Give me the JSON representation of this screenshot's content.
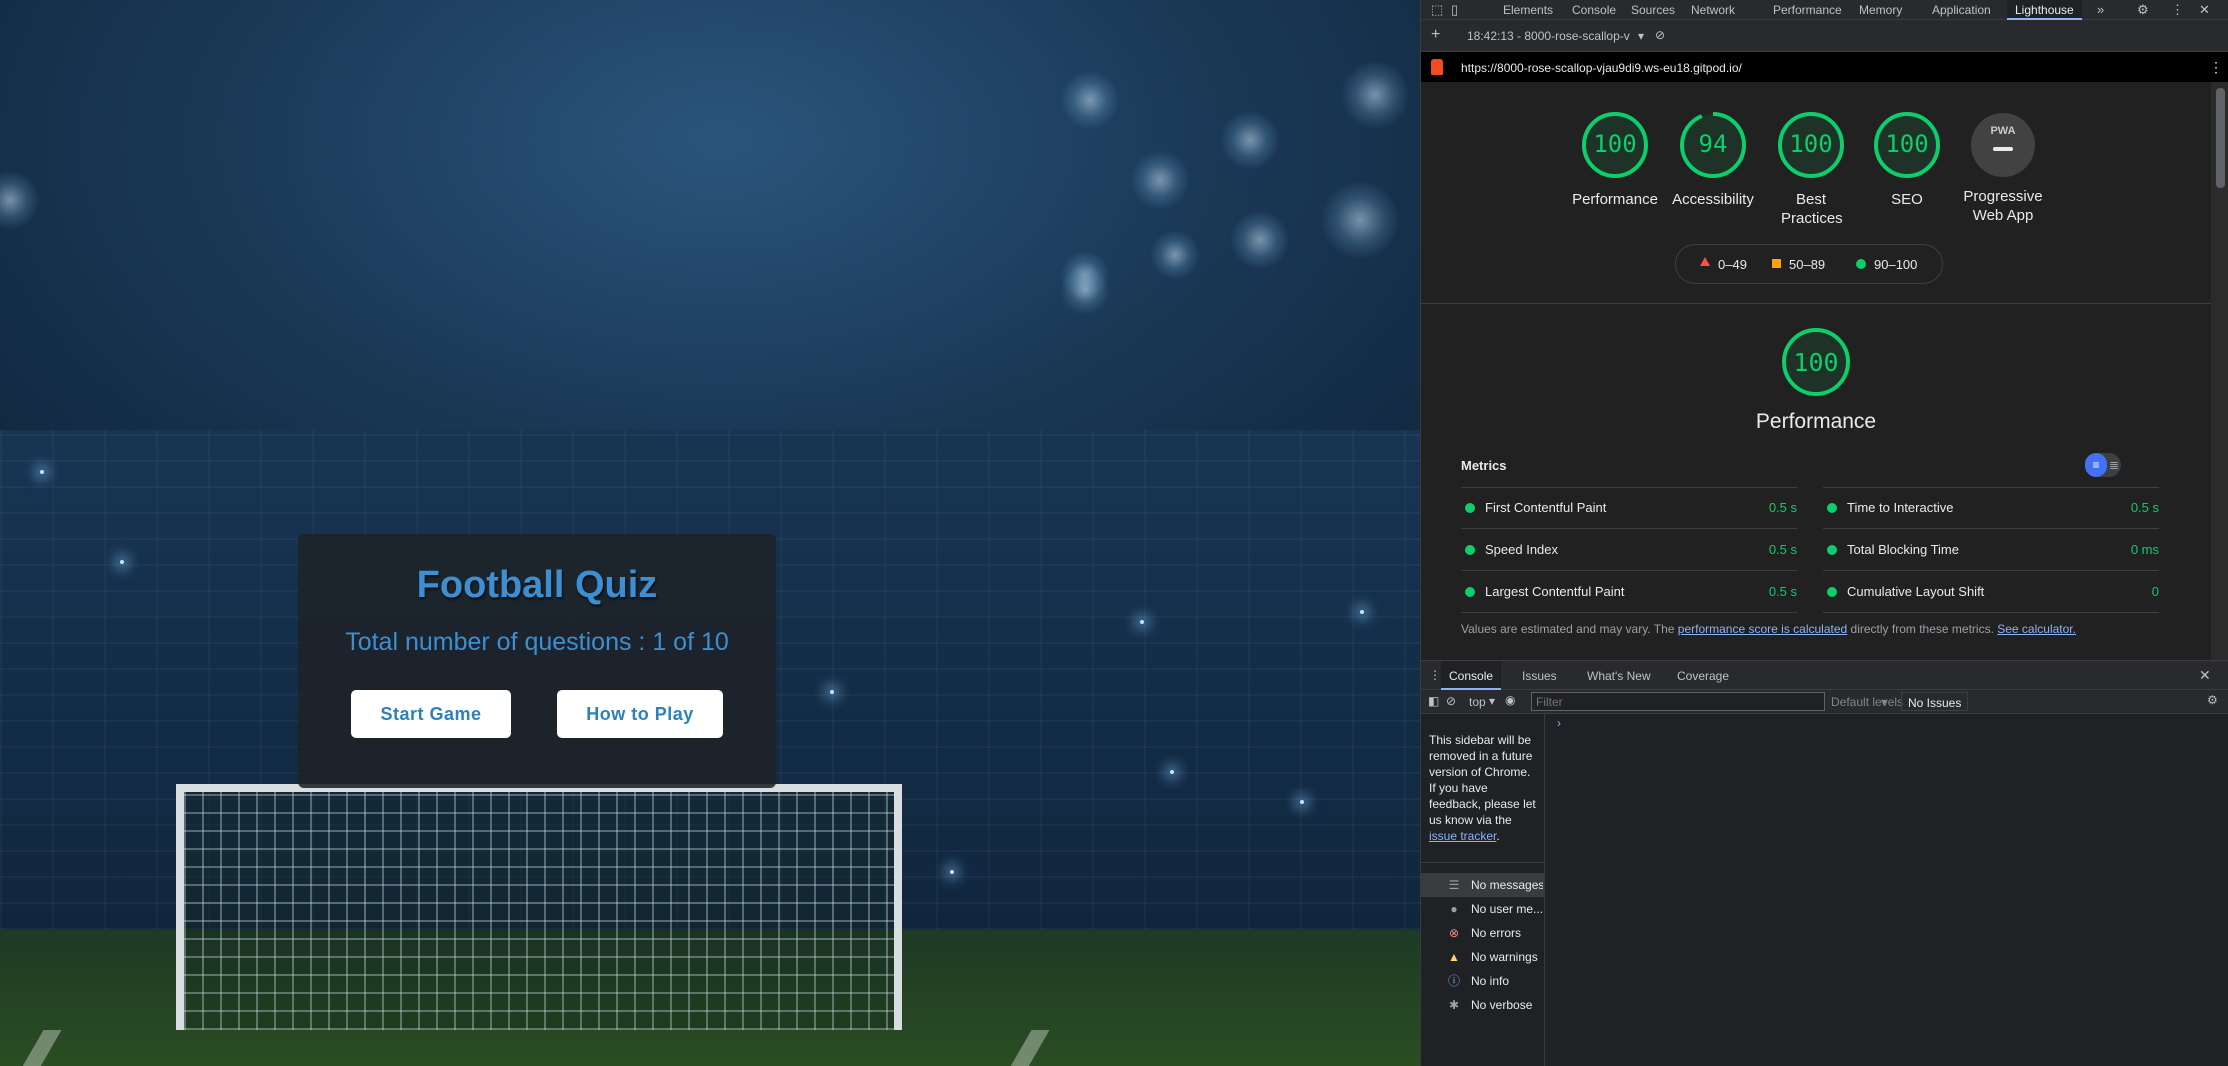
{
  "quiz": {
    "title": "Football Quiz",
    "progress_text": "Total number of questions : 1 of 10",
    "start_button": "Start Game",
    "howto_button": "How to Play"
  },
  "devtools": {
    "tabs": [
      "Elements",
      "Console",
      "Sources",
      "Network",
      "Performance",
      "Memory",
      "Application",
      "Lighthouse"
    ],
    "active_tab": "Lighthouse",
    "report_selector": "18:42:13 - 8000-rose-scallop-v",
    "report_url": "https://8000-rose-scallop-vjau9di9.ws-eu18.gitpod.io/",
    "scores": [
      {
        "label": "Performance",
        "value": "100",
        "fraction": 1.0
      },
      {
        "label": "Accessibility",
        "value": "94",
        "fraction": 0.94
      },
      {
        "label": "Best Practices",
        "value": "100",
        "fraction": 1.0
      },
      {
        "label": "SEO",
        "value": "100",
        "fraction": 1.0
      },
      {
        "label": "Progressive Web App",
        "value": "PWA"
      }
    ],
    "legend": [
      "0–49",
      "50–89",
      "90–100"
    ],
    "perf_score": "100",
    "perf_title": "Performance",
    "metrics_title": "Metrics",
    "metrics": [
      {
        "name": "First Contentful Paint",
        "value": "0.5 s"
      },
      {
        "name": "Time to Interactive",
        "value": "0.5 s"
      },
      {
        "name": "Speed Index",
        "value": "0.5 s"
      },
      {
        "name": "Total Blocking Time",
        "value": "0 ms"
      },
      {
        "name": "Largest Contentful Paint",
        "value": "0.5 s"
      },
      {
        "name": "Cumulative Layout Shift",
        "value": "0"
      }
    ],
    "note_prefix": "Values are estimated and may vary. The ",
    "note_link1": "performance score is calculated",
    "note_mid": " directly from these metrics. ",
    "note_link2": "See calculator.",
    "drawer_tabs": [
      "Console",
      "Issues",
      "What's New",
      "Coverage"
    ],
    "context": "top",
    "filter_placeholder": "Filter",
    "levels": "Default levels",
    "issues": "No Issues",
    "sidebar_msg": "This sidebar will be removed in a future version of Chrome. If you have feedback, please let us know via the ",
    "sidebar_link": "issue tracker",
    "sidebar_items": [
      "No messages",
      "No user me...",
      "No errors",
      "No warnings",
      "No info",
      "No verbose"
    ],
    "colors": {
      "pass": "#0cce6b",
      "average": "#ffa400",
      "fail": "#ff4e42",
      "accent": "#8ab4f8"
    }
  }
}
